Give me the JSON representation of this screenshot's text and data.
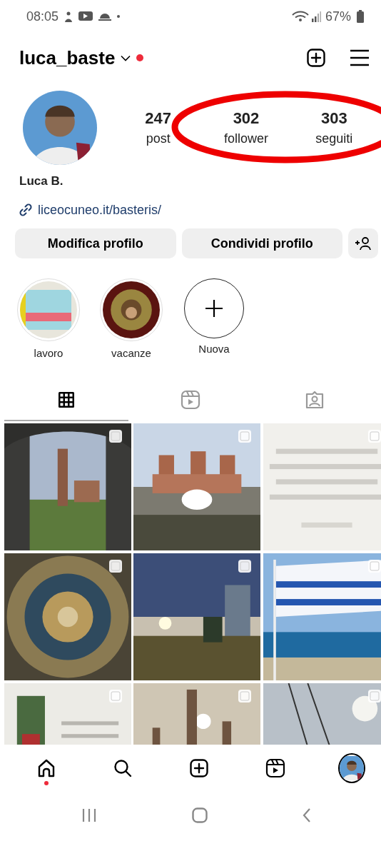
{
  "status_bar": {
    "time": "08:05",
    "battery": "67%"
  },
  "header": {
    "username": "luca_baste",
    "notification_dot": true
  },
  "profile": {
    "stats": [
      {
        "value": "247",
        "label": "post"
      },
      {
        "value": "302",
        "label": "follower"
      },
      {
        "value": "303",
        "label": "seguiti"
      }
    ],
    "name": "Luca B.",
    "link": "liceocuneo.it/basteris/"
  },
  "buttons": [
    "Modifica profilo",
    "Condividi profilo"
  ],
  "highlights": [
    {
      "kind": "picture",
      "label": "lavoro"
    },
    {
      "kind": "picture",
      "label": "vacanze"
    },
    {
      "kind": "new",
      "label": "Nuova"
    }
  ],
  "tabs": [
    {
      "kind": "grid",
      "selected": true
    },
    {
      "kind": "reels",
      "selected": false
    },
    {
      "kind": "tagged",
      "selected": false
    }
  ],
  "posts": [
    {
      "kind": "picture",
      "multiple": true
    },
    {
      "kind": "picture",
      "multiple": true
    },
    {
      "kind": "picture",
      "multiple": true
    },
    {
      "kind": "picture",
      "multiple": true
    },
    {
      "kind": "picture",
      "multiple": true
    },
    {
      "kind": "picture",
      "multiple": true
    },
    {
      "kind": "picture",
      "multiple": true
    },
    {
      "kind": "picture",
      "multiple": true
    },
    {
      "kind": "picture",
      "multiple": true
    }
  ],
  "bottom_nav": [
    {
      "kind": "home",
      "notification_dot": true
    },
    {
      "kind": "search",
      "notification_dot": false
    },
    {
      "kind": "create",
      "notification_dot": false
    },
    {
      "kind": "reels",
      "notification_dot": false
    },
    {
      "kind": "profile",
      "notification_dot": false
    }
  ],
  "annotations": [
    {
      "kind": "ellipse"
    }
  ]
}
